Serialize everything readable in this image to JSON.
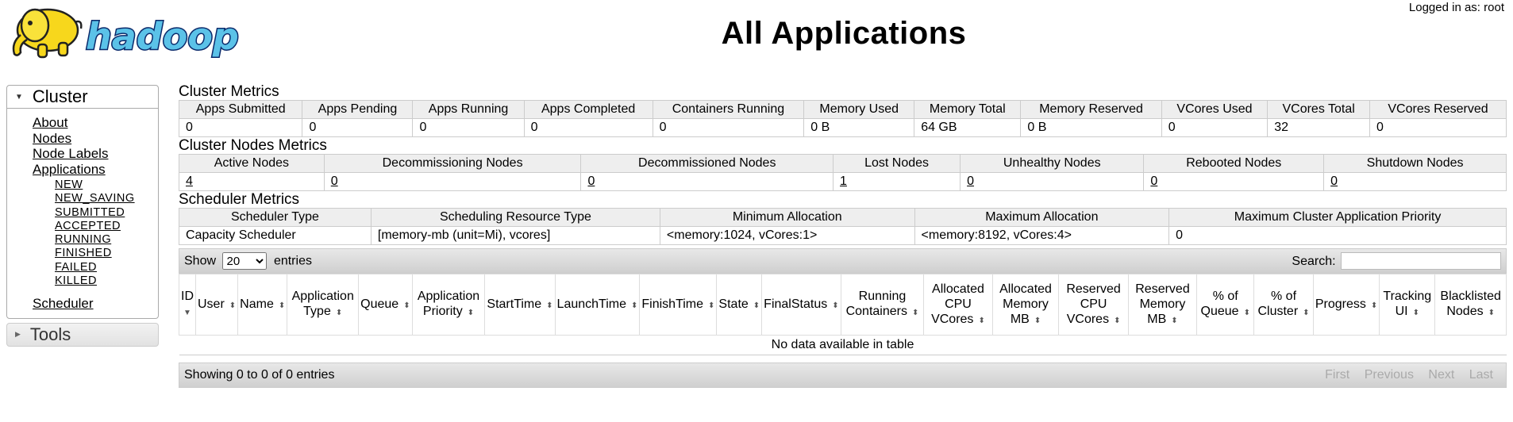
{
  "header": {
    "title": "All Applications",
    "user_info": "Logged in as: root",
    "logo_text": "hadoop"
  },
  "sidebar": {
    "cluster": {
      "label": "Cluster",
      "links": [
        "About",
        "Nodes",
        "Node Labels",
        "Applications"
      ],
      "states": [
        "NEW",
        "NEW_SAVING",
        "SUBMITTED",
        "ACCEPTED",
        "RUNNING",
        "FINISHED",
        "FAILED",
        "KILLED"
      ],
      "scheduler": "Scheduler"
    },
    "tools": {
      "label": "Tools"
    }
  },
  "cluster_metrics": {
    "title": "Cluster Metrics",
    "headers": [
      "Apps Submitted",
      "Apps Pending",
      "Apps Running",
      "Apps Completed",
      "Containers Running",
      "Memory Used",
      "Memory Total",
      "Memory Reserved",
      "VCores Used",
      "VCores Total",
      "VCores Reserved"
    ],
    "values": [
      "0",
      "0",
      "0",
      "0",
      "0",
      "0 B",
      "64 GB",
      "0 B",
      "0",
      "32",
      "0"
    ]
  },
  "nodes_metrics": {
    "title": "Cluster Nodes Metrics",
    "headers": [
      "Active Nodes",
      "Decommissioning Nodes",
      "Decommissioned Nodes",
      "Lost Nodes",
      "Unhealthy Nodes",
      "Rebooted Nodes",
      "Shutdown Nodes"
    ],
    "values": [
      "4",
      "0",
      "0",
      "1",
      "0",
      "0",
      "0"
    ]
  },
  "scheduler_metrics": {
    "title": "Scheduler Metrics",
    "headers": [
      "Scheduler Type",
      "Scheduling Resource Type",
      "Minimum Allocation",
      "Maximum Allocation",
      "Maximum Cluster Application Priority"
    ],
    "values": [
      "Capacity Scheduler",
      "[memory-mb (unit=Mi), vcores]",
      "<memory:1024, vCores:1>",
      "<memory:8192, vCores:4>",
      "0"
    ]
  },
  "apps_table": {
    "show_label": "Show",
    "entries_label": "entries",
    "page_size": "20",
    "search_label": "Search:",
    "search_value": "",
    "columns": [
      "ID",
      "User",
      "Name",
      "Application Type",
      "Queue",
      "Application Priority",
      "StartTime",
      "LaunchTime",
      "FinishTime",
      "State",
      "FinalStatus",
      "Running Containers",
      "Allocated CPU VCores",
      "Allocated Memory MB",
      "Reserved CPU VCores",
      "Reserved Memory MB",
      "% of Queue",
      "% of Cluster",
      "Progress",
      "Tracking UI",
      "Blacklisted Nodes"
    ],
    "empty_message": "No data available in table",
    "info": "Showing 0 to 0 of 0 entries",
    "pager": [
      "First",
      "Previous",
      "Next",
      "Last"
    ]
  }
}
